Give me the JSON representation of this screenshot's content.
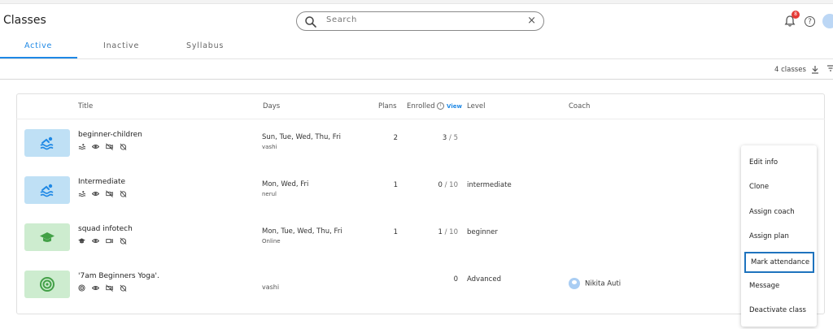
{
  "page": {
    "title": "Classes"
  },
  "search": {
    "placeholder": "Search",
    "clear_label": "×"
  },
  "header": {
    "notification_count": "8",
    "help_label": "?"
  },
  "tabs": [
    {
      "label": "Active"
    },
    {
      "label": "Inactive"
    },
    {
      "label": "Syllabus"
    }
  ],
  "toolbar": {
    "count_label": "4 classes"
  },
  "table": {
    "headers": {
      "title": "Title",
      "days": "Days",
      "plans": "Plans",
      "enrolled": "Enrolled",
      "info": "i",
      "view": "View",
      "level": "Level",
      "coach": "Coach"
    },
    "rows": [
      {
        "title": "beginner-children",
        "days": "Sun, Tue, Wed, Thu, Fri",
        "location": "vashi",
        "plans": "2",
        "enrolled": "3",
        "capacity": "/ 5",
        "level": "",
        "coach": "",
        "thumb_color": "#bfe0f5",
        "thumb_icon": "swim-icon",
        "type_icon": "swim-icon"
      },
      {
        "title": "Intermediate",
        "days": "Mon, Wed, Fri",
        "location": "nerul",
        "plans": "1",
        "enrolled": "0",
        "capacity": "/ 10",
        "level": "intermediate",
        "coach": "",
        "thumb_color": "#bfe0f5",
        "thumb_icon": "swim-icon",
        "type_icon": "swim-icon"
      },
      {
        "title": "squad infotech",
        "days": "Mon, Tue, Wed, Thu, Fri",
        "location": "Online",
        "plans": "1",
        "enrolled": "1",
        "capacity": "/ 10",
        "level": "beginner",
        "coach": "",
        "thumb_color": "#cdeccf",
        "thumb_icon": "graduation-cap-icon",
        "type_icon": "graduation-cap-icon"
      },
      {
        "title": "'7am Beginners Yoga'.",
        "days": "",
        "location": "vashi",
        "plans": "",
        "enrolled": "0",
        "capacity": "",
        "level": "Advanced",
        "coach": "Nikita Auti",
        "thumb_color": "#cdeccf",
        "thumb_icon": "target-icon",
        "type_icon": "target-icon"
      }
    ]
  },
  "context_menu": {
    "items": [
      {
        "label": "Edit info"
      },
      {
        "label": "Clone"
      },
      {
        "label": "Assign coach"
      },
      {
        "label": "Assign plan"
      },
      {
        "label": "Mark attendance",
        "highlighted": true
      },
      {
        "label": "Message"
      },
      {
        "label": "Deactivate class"
      }
    ]
  },
  "colors": {
    "accent": "#1e88e5",
    "badge": "#e53935",
    "blue_thumb": "#bfe0f5",
    "green_thumb": "#cdeccf",
    "menu_highlight": "#1e73be"
  }
}
